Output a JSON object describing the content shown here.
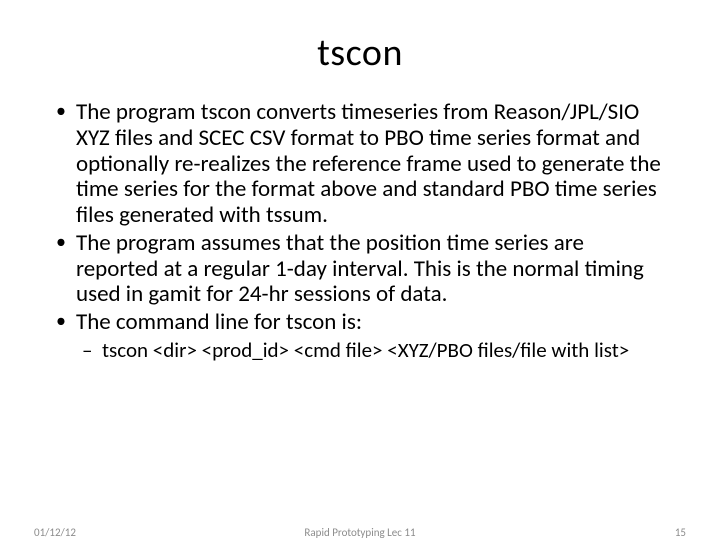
{
  "title": "tscon",
  "bullets": {
    "b1": "The program tscon converts timeseries from Reason/JPL/SIO XYZ files and SCEC CSV format to PBO time series format and optionally re-realizes the reference frame used to generate the time series for the format above and standard PBO time series files generated with tssum.",
    "b2": "The program assumes that the position time series are reported at a regular 1-day interval.  This is the normal timing used in gamit for 24-hr sessions of data.",
    "b3": "The command line for tscon is:",
    "b3_sub1": "tscon <dir> <prod_id> <cmd file> <XYZ/PBO files/file with list>"
  },
  "footer": {
    "date": "01/12/12",
    "center": "Rapid Prototyping Lec 11",
    "page": "15"
  }
}
